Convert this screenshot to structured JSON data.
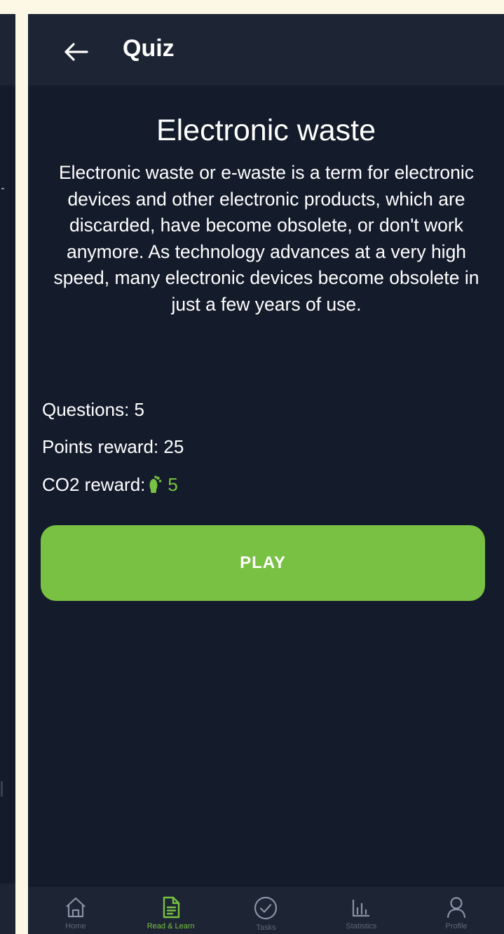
{
  "app_bar": {
    "title": "Quiz",
    "back_icon": "arrow-left-icon"
  },
  "quiz": {
    "title": "Electronic waste",
    "description": "Electronic waste or e-waste is a term for electronic devices and other electronic products, which are discarded, have become obsolete, or don't work anymore. As technology advances at a very high speed, many electronic devices become obsolete in just a few years of use.",
    "questions_label": "Questions:",
    "questions_value": "5",
    "points_label": "Points reward:",
    "points_value": "25",
    "co2_label": "CO2 reward:",
    "co2_icon": "footprint-icon",
    "co2_value": "5"
  },
  "play_button": {
    "label": "PLAY"
  },
  "bottom_nav": {
    "items": [
      {
        "icon": "home-icon",
        "label": "Home"
      },
      {
        "icon": "document-icon",
        "label": "Read & Learn"
      },
      {
        "icon": "check-circle-icon",
        "label": "Tasks"
      },
      {
        "icon": "bar-chart-icon",
        "label": "Statistics"
      },
      {
        "icon": "person-icon",
        "label": "Profile"
      }
    ],
    "active_index": 1
  },
  "colors": {
    "accent": "#78c143",
    "background": "#141b2b",
    "bar": "#1d2433",
    "inactive_icon": "#8a93a4",
    "page_background": "#fdf7e6"
  }
}
